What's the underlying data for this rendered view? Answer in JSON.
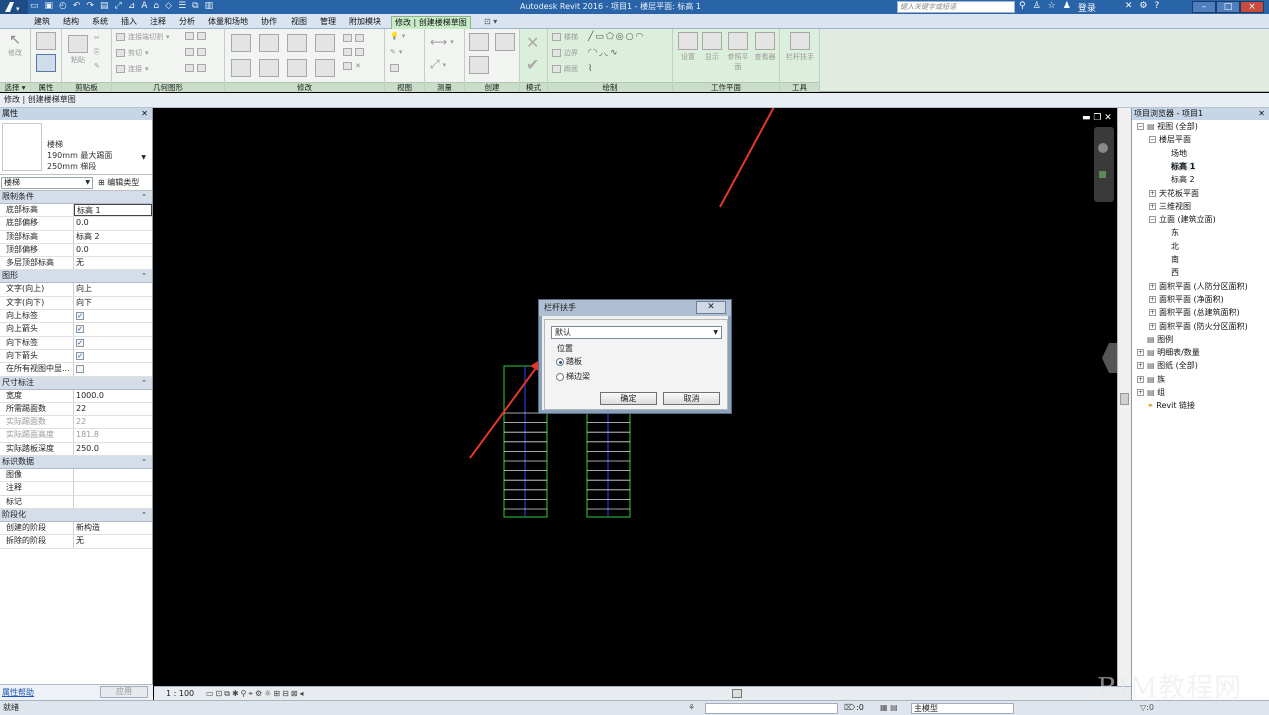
{
  "app": {
    "title": "Autodesk Revit 2016 -    项目1 - 楼层平面: 标高 1",
    "search_placeholder": "键入关键字或短语",
    "login": "登录",
    "help_icon": "?",
    "window_buttons": [
      "–",
      "□",
      "×"
    ]
  },
  "tabs": [
    "建筑",
    "结构",
    "系统",
    "插入",
    "注释",
    "分析",
    "体量和场地",
    "协作",
    "视图",
    "管理",
    "附加模块",
    "修改 | 创建楼梯草图"
  ],
  "ribbon": {
    "panels": [
      "选择 ▾",
      "属性",
      "剪贴板",
      "几何图形",
      "修改",
      "视图",
      "测量",
      "创建",
      "模式",
      "绘制",
      "工作平面",
      "工具"
    ],
    "modify_label": "修改",
    "paste_label": "粘贴",
    "geometry_items": [
      "连接端切割",
      "剪切",
      "连接"
    ],
    "draw_items": [
      "楼梯",
      "边界",
      "踢面"
    ],
    "workplane_items": [
      "设置",
      "显示",
      "参照平面",
      "查看器"
    ],
    "tool_item": "栏杆扶手"
  },
  "option_bar": "修改 | 创建楼梯草图",
  "properties": {
    "title": "属性",
    "type_family": "楼梯",
    "type_name_1": "190mm 最大踢面",
    "type_name_2": "250mm 梯段",
    "selector": "楼梯",
    "edit_type": "编辑类型",
    "groups": [
      {
        "name": "限制条件",
        "rows": [
          [
            "底部标高",
            "标高 1"
          ],
          [
            "底部偏移",
            "0.0"
          ],
          [
            "顶部标高",
            "标高 2"
          ],
          [
            "顶部偏移",
            "0.0"
          ],
          [
            "多层顶部标高",
            "无"
          ]
        ]
      },
      {
        "name": "图形",
        "rows": [
          [
            "文字(向上)",
            "向上"
          ],
          [
            "文字(向下)",
            "向下"
          ],
          [
            "向上标签",
            "✓"
          ],
          [
            "向上箭头",
            "✓"
          ],
          [
            "向下标签",
            "✓"
          ],
          [
            "向下箭头",
            "✓"
          ],
          [
            "在所有视图中显...",
            ""
          ]
        ]
      },
      {
        "name": "尺寸标注",
        "rows": [
          [
            "宽度",
            "1000.0"
          ],
          [
            "所需踢面数",
            "22"
          ],
          [
            "实际踢面数",
            "22"
          ],
          [
            "实际踢面高度",
            "181.8"
          ],
          [
            "实际踏板深度",
            "250.0"
          ]
        ]
      },
      {
        "name": "标识数据",
        "rows": [
          [
            "图像",
            ""
          ],
          [
            "注释",
            ""
          ],
          [
            "标记",
            ""
          ]
        ]
      },
      {
        "name": "阶段化",
        "rows": [
          [
            "创建的阶段",
            "新构造"
          ],
          [
            "拆除的阶段",
            "无"
          ]
        ]
      }
    ],
    "help_link": "属性帮助",
    "apply": "应用"
  },
  "browser": {
    "title": "项目浏览器 - 项目1",
    "nodes": [
      "视图 (全部)",
      "楼层平面",
      "场地",
      "标高 1",
      "标高 2",
      "天花板平面",
      "三维视图",
      "立面 (建筑立面)",
      "东",
      "北",
      "南",
      "西",
      "面积平面 (人防分区面积)",
      "面积平面 (净面积)",
      "面积平面 (总建筑面积)",
      "面积平面 (防火分区面积)",
      "图例",
      "明细表/数量",
      "图纸 (全部)",
      "族",
      "组",
      "Revit 链接"
    ]
  },
  "dialog": {
    "title": "栏杆扶手",
    "selected_type": "默认",
    "position_label": "位置",
    "options": [
      "踏板",
      "梯边梁"
    ],
    "selected_option": "踏板",
    "ok": "确定",
    "cancel": "取消"
  },
  "view_bar": {
    "scale": "1 : 100"
  },
  "status": {
    "left": "就绪",
    "coord": ":0",
    "model": "主模型"
  },
  "watermark": "BIM教程网",
  "colors": {
    "stair_outline": "#33cc33",
    "stair_center": "#3344ff",
    "arrow": "#e0392b"
  }
}
